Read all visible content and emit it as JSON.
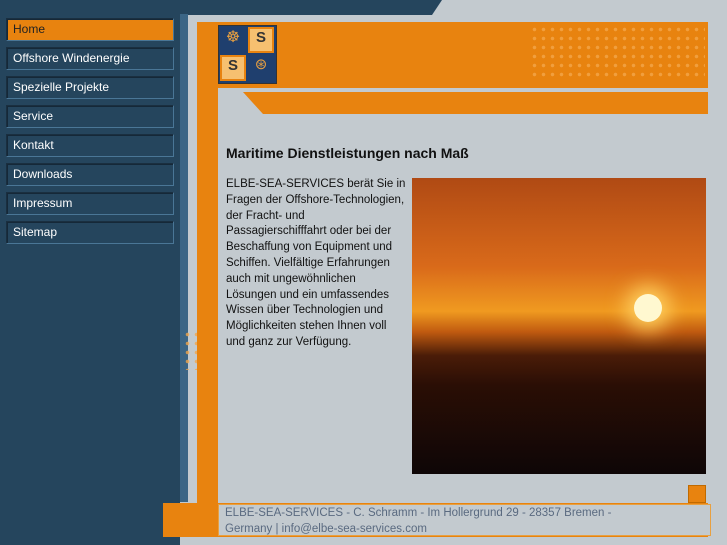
{
  "nav": [
    {
      "label": "Home",
      "active": true
    },
    {
      "label": "Offshore Windenergie"
    },
    {
      "label": "Spezielle Projekte"
    },
    {
      "label": "Service"
    },
    {
      "label": "Kontakt"
    },
    {
      "label": "Downloads"
    },
    {
      "label": "Impressum"
    },
    {
      "label": "Sitemap"
    }
  ],
  "main": {
    "heading": "Maritime Dienstleistungen nach Maß",
    "body": "ELBE-SEA-SERVICES berät Sie in Fragen der Offshore-Technologien, der Fracht- und Passagierschifffahrt oder bei der Beschaffung von Equipment und Schiffen. Vielfältige Erfahrungen auch mit ungewöhnlichen Lösungen und ein umfassendes Wissen über Technologien und Möglichkeiten stehen Ihnen voll und ganz zur Verfügung."
  },
  "logo": {
    "letters": "S S"
  },
  "footer": {
    "line1": "ELBE-SEA-SERVICES - C. Schramm - Im Hollergrund 29 - 28357 Bremen -",
    "line2": "Germany | info@elbe-sea-services.com"
  }
}
